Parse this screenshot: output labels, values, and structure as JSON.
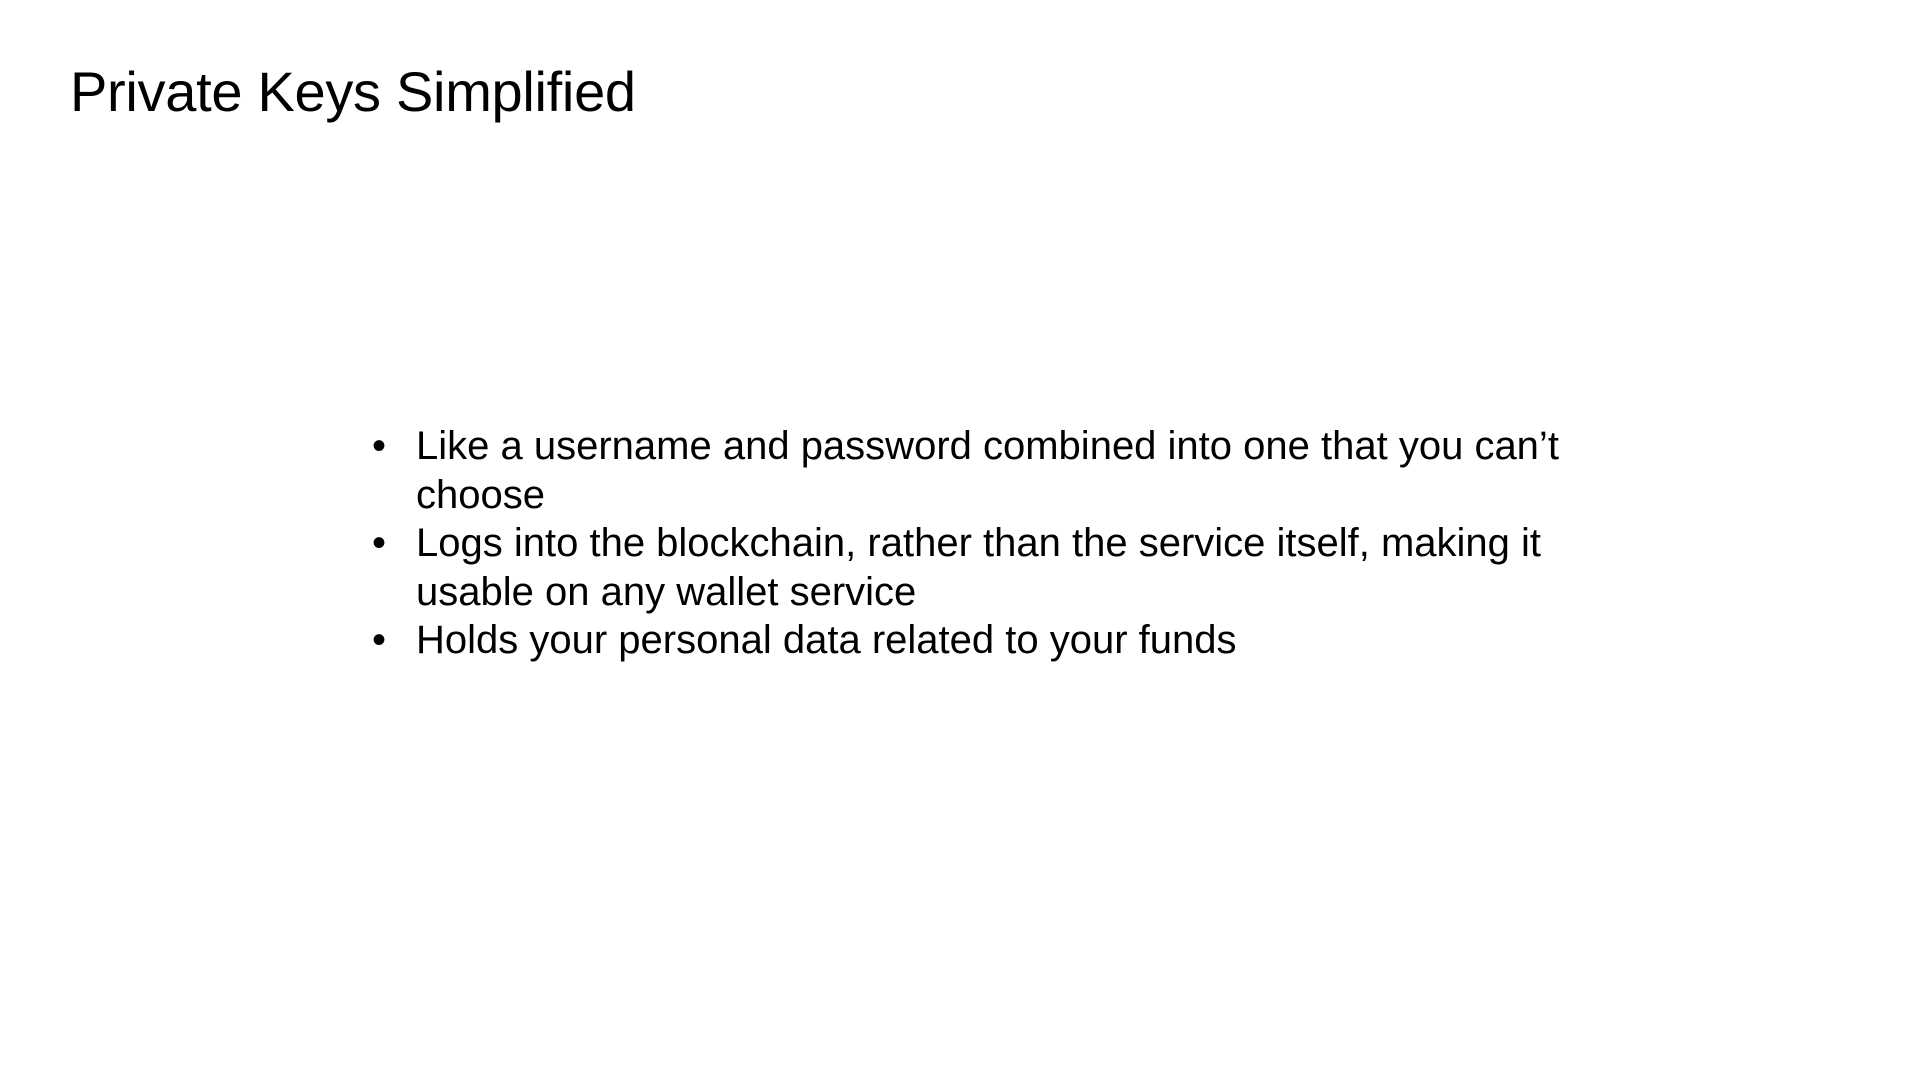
{
  "slide": {
    "title": "Private Keys Simplified",
    "bullet_symbol": "•",
    "bullets": [
      "Like a username and password combined into one that you can’t choose",
      "Logs into the blockchain, rather than the service itself, making it usable on any wallet service",
      "Holds your personal data related to your funds"
    ]
  }
}
